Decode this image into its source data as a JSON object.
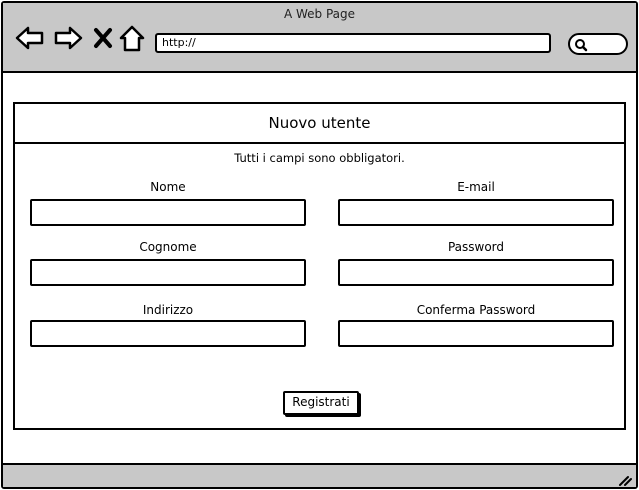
{
  "browser": {
    "window_title": "A Web Page",
    "url": "http://",
    "icons": {
      "back": "arrow-left-icon",
      "forward": "arrow-right-icon",
      "stop": "close-icon",
      "home": "home-icon",
      "search": "search-icon",
      "resize": "resize-grip-icon"
    },
    "chrome_color": "#c8c8c8"
  },
  "form": {
    "title": "Nuovo utente",
    "subtitle": "Tutti i campi sono obbligatori.",
    "fields": {
      "nome": {
        "label": "Nome",
        "value": ""
      },
      "email": {
        "label": "E-mail",
        "value": ""
      },
      "cognome": {
        "label": "Cognome",
        "value": ""
      },
      "password": {
        "label": "Password",
        "value": ""
      },
      "indirizzo": {
        "label": "Indirizzo",
        "value": ""
      },
      "conferma_password": {
        "label": "Conferma Password",
        "value": ""
      }
    },
    "submit_label": "Registrati"
  }
}
